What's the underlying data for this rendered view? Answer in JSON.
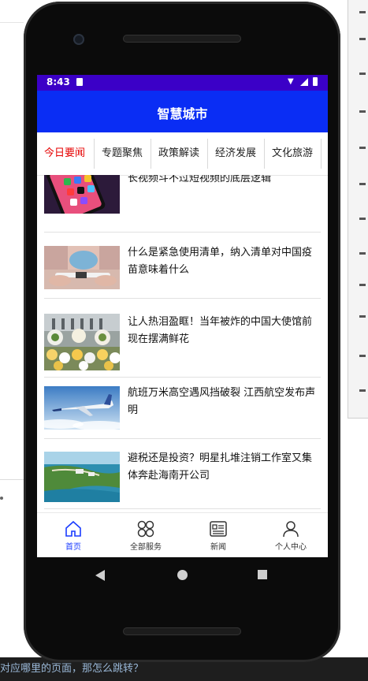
{
  "status": {
    "time": "8:43"
  },
  "app": {
    "title": "智慧城市"
  },
  "tabs": [
    {
      "label": "今日要闻",
      "active": true
    },
    {
      "label": "专题聚焦",
      "active": false
    },
    {
      "label": "政策解读",
      "active": false
    },
    {
      "label": "经济发展",
      "active": false
    },
    {
      "label": "文化旅游",
      "active": false
    }
  ],
  "news": [
    {
      "headline": "长视频斗不过短视频的底层逻辑",
      "thumb": "phone-apps-image"
    },
    {
      "headline": "什么是紧急使用清单，纳入清单对中国疫苗意味着什么",
      "thumb": "vaccine-vial-image"
    },
    {
      "headline": "让人热泪盈眶！当年被炸的中国大使馆前现在摆满鲜花",
      "thumb": "flower-wreaths-image"
    },
    {
      "headline": "航班万米高空遇风挡破裂 江西航空发布声明",
      "thumb": "airplane-image"
    },
    {
      "headline": "避税还是投资？明星扎堆注销工作室又集体奔赴海南开公司",
      "thumb": "hainan-coast-image"
    }
  ],
  "bottom_nav": [
    {
      "label": "首页",
      "icon": "home-icon",
      "active": true
    },
    {
      "label": "全部服务",
      "icon": "services-grid-icon",
      "active": false
    },
    {
      "label": "新闻",
      "icon": "news-icon",
      "active": false
    },
    {
      "label": "个人中心",
      "icon": "person-icon",
      "active": false
    }
  ],
  "background": {
    "bottom_text": "对应哪里的页面，那怎么跳转？"
  },
  "colors": {
    "status_bar": "#3b00c7",
    "app_bar": "#0a2df4",
    "active_tab": "#e60000",
    "active_nav": "#1a3cff"
  }
}
